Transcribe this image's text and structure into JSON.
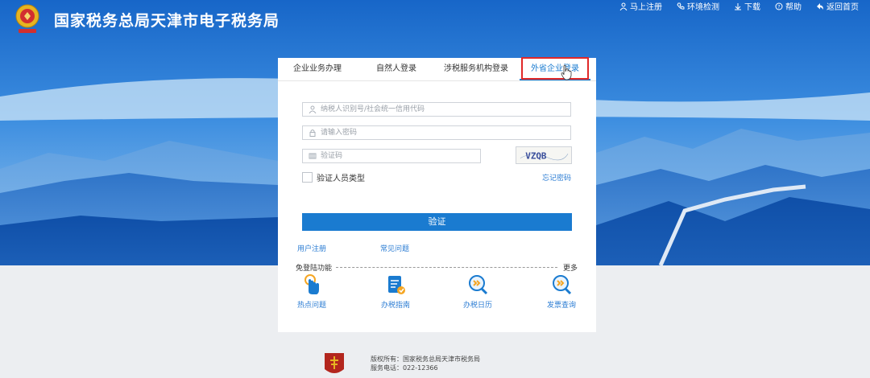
{
  "header": {
    "title": "国家税务总局天津市电子税务局",
    "nav": [
      {
        "label": "马上注册",
        "icon": "user-icon"
      },
      {
        "label": "环境检测",
        "icon": "phone-icon"
      },
      {
        "label": "下载",
        "icon": "download-icon"
      },
      {
        "label": "帮助",
        "icon": "help-icon"
      },
      {
        "label": "返回首页",
        "icon": "back-icon"
      }
    ]
  },
  "login": {
    "tabs": [
      "企业业务办理",
      "自然人登录",
      "涉税服务机构登录",
      "外省企业登录"
    ],
    "active_tab": 3,
    "taxpayer_placeholder": "纳税人识别号/社会统一信用代码",
    "password_placeholder": "请输入密码",
    "captcha_placeholder": "验证码",
    "captcha_text": "VZQB",
    "verify_type_label": "验证人员类型",
    "forgot_label": "忘记密码",
    "submit_label": "验证",
    "register_label": "用户注册",
    "faq_label": "常见问题",
    "free_label": "免登陆功能",
    "more_label": "更多",
    "shortcuts": [
      "热点问题",
      "办税指南",
      "办税日历",
      "发票查询"
    ]
  },
  "footer": {
    "copyright": "版权所有：国家税务总局天津市税务局",
    "phone": "服务电话：022-12366"
  },
  "colors": {
    "accent": "#1a7bd0",
    "highlight": "#e02828",
    "header_blue": "#1565c0"
  }
}
